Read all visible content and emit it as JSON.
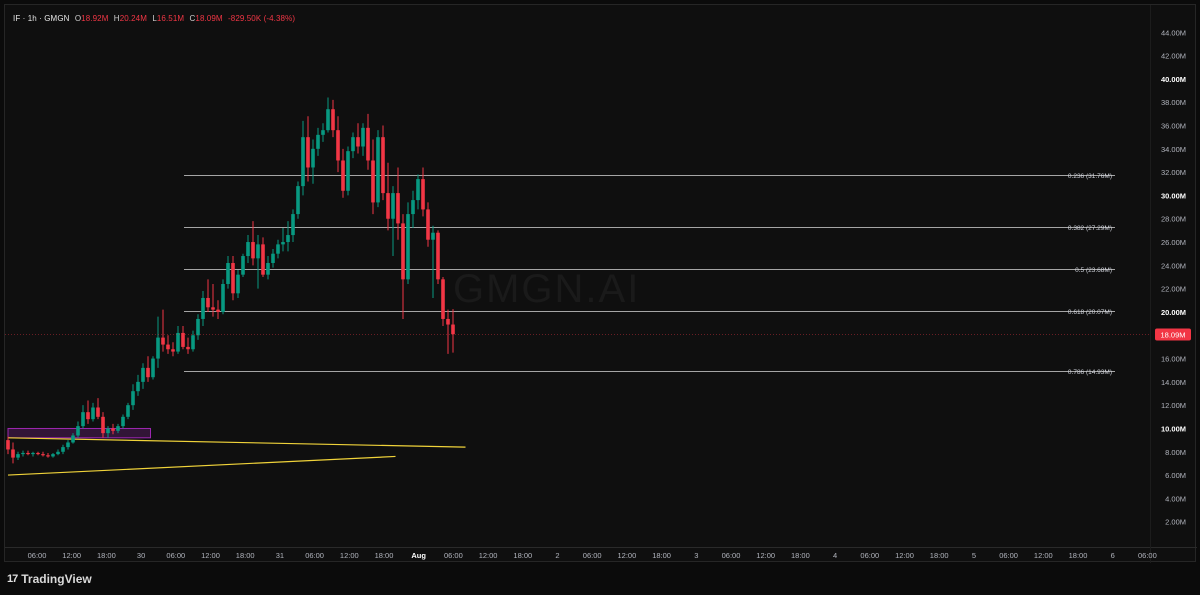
{
  "header": {
    "symbol": "IF · 1h · GMGN",
    "open_key": "O",
    "open": "18.92M",
    "high_key": "H",
    "high": "20.24M",
    "low_key": "L",
    "low": "16.51M",
    "close_key": "C",
    "close": "18.09M",
    "change": "-829.50K (-4.38%)"
  },
  "watermark": "GMGN.AI",
  "brand": {
    "icon": "tradingview-logo-icon",
    "name": "TradingView"
  },
  "colors": {
    "up": "#089981",
    "down": "#f23645",
    "fib_line": "#d9d9d9",
    "trendline": "#f0d33a",
    "box_border": "#9c27b0",
    "price_tag": "#f23645"
  },
  "chart_data": {
    "type": "candlestick",
    "interval": "1h",
    "y_axis": {
      "position": "right",
      "ticks": [
        "2.00M",
        "4.00M",
        "6.00M",
        "8.00M",
        "10.00M",
        "12.00M",
        "14.00M",
        "16.00M",
        "18.00M",
        "20.00M",
        "22.00M",
        "24.00M",
        "26.00M",
        "28.00M",
        "30.00M",
        "32.00M",
        "34.00M",
        "36.00M",
        "38.00M",
        "40.00M",
        "42.00M",
        "44.00M"
      ],
      "bold_ticks": [
        "10.00M",
        "20.00M",
        "30.00M",
        "40.00M"
      ],
      "range": [
        0,
        46
      ]
    },
    "x_axis": {
      "labels": [
        "06:00",
        "12:00",
        "18:00",
        "30",
        "06:00",
        "12:00",
        "18:00",
        "31",
        "06:00",
        "12:00",
        "18:00",
        "Aug",
        "06:00",
        "12:00",
        "18:00",
        "2",
        "06:00",
        "12:00",
        "18:00",
        "3",
        "06:00",
        "12:00",
        "18:00",
        "4",
        "06:00",
        "12:00",
        "18:00",
        "5",
        "06:00",
        "12:00",
        "18:00",
        "6",
        "06:00"
      ],
      "bold_labels": [
        "Aug"
      ]
    },
    "last_price_label": "18.09M",
    "last_price": 18.09,
    "fibonacci": [
      {
        "label": "0.236 (31.76M)",
        "value": 31.76
      },
      {
        "label": "0.382 (27.29M)",
        "value": 27.29
      },
      {
        "label": "0.5 (23.68M)",
        "value": 23.68
      },
      {
        "label": "0.618 (20.07M)",
        "value": 20.07
      },
      {
        "label": "0.786 (14.93M)",
        "value": 14.93
      }
    ],
    "candles": [
      [
        9.0,
        9.3,
        7.8,
        8.2
      ],
      [
        8.2,
        8.8,
        7.0,
        7.5
      ],
      [
        7.5,
        8.0,
        7.3,
        7.8
      ],
      [
        7.8,
        8.1,
        7.6,
        7.9
      ],
      [
        7.9,
        8.1,
        7.7,
        7.8
      ],
      [
        7.8,
        8.0,
        7.6,
        7.9
      ],
      [
        7.9,
        8.0,
        7.7,
        7.8
      ],
      [
        7.8,
        8.0,
        7.6,
        7.7
      ],
      [
        7.7,
        7.9,
        7.5,
        7.6
      ],
      [
        7.6,
        7.9,
        7.5,
        7.8
      ],
      [
        7.8,
        8.2,
        7.7,
        8.0
      ],
      [
        8.0,
        8.6,
        7.8,
        8.4
      ],
      [
        8.4,
        9.0,
        8.2,
        8.8
      ],
      [
        8.8,
        9.6,
        8.7,
        9.4
      ],
      [
        9.4,
        10.6,
        9.2,
        10.2
      ],
      [
        10.2,
        12.0,
        10.0,
        11.4
      ],
      [
        11.4,
        12.4,
        10.4,
        10.8
      ],
      [
        10.8,
        12.2,
        10.6,
        11.8
      ],
      [
        11.8,
        12.6,
        10.8,
        11.0
      ],
      [
        11.0,
        11.4,
        9.2,
        9.6
      ],
      [
        9.6,
        10.2,
        9.2,
        10.0
      ],
      [
        10.0,
        10.4,
        9.5,
        9.8
      ],
      [
        9.8,
        10.4,
        9.6,
        10.2
      ],
      [
        10.2,
        11.2,
        10.0,
        11.0
      ],
      [
        11.0,
        12.2,
        10.8,
        12.0
      ],
      [
        12.0,
        13.8,
        11.6,
        13.2
      ],
      [
        13.2,
        14.6,
        12.8,
        14.0
      ],
      [
        14.0,
        15.6,
        13.4,
        15.2
      ],
      [
        15.2,
        16.2,
        14.0,
        14.4
      ],
      [
        14.4,
        16.2,
        14.2,
        16.0
      ],
      [
        16.0,
        19.6,
        15.2,
        17.8
      ],
      [
        17.8,
        20.2,
        16.6,
        17.2
      ],
      [
        17.2,
        18.0,
        16.4,
        16.8
      ],
      [
        16.8,
        17.4,
        16.2,
        16.6
      ],
      [
        16.6,
        18.8,
        16.4,
        18.2
      ],
      [
        18.2,
        18.8,
        16.8,
        17.0
      ],
      [
        17.0,
        17.8,
        16.4,
        16.8
      ],
      [
        16.8,
        18.4,
        16.6,
        18.0
      ],
      [
        18.0,
        19.8,
        17.6,
        19.4
      ],
      [
        19.4,
        21.8,
        18.8,
        21.2
      ],
      [
        21.2,
        22.8,
        20.0,
        20.4
      ],
      [
        20.4,
        22.4,
        19.6,
        20.2
      ],
      [
        20.2,
        21.0,
        19.4,
        20.0
      ],
      [
        20.0,
        22.8,
        19.8,
        22.4
      ],
      [
        22.4,
        24.8,
        22.0,
        24.2
      ],
      [
        24.2,
        24.8,
        21.0,
        21.6
      ],
      [
        21.6,
        23.6,
        21.2,
        23.2
      ],
      [
        23.2,
        25.0,
        23.0,
        24.8
      ],
      [
        24.8,
        26.6,
        24.2,
        26.0
      ],
      [
        26.0,
        27.8,
        24.0,
        24.6
      ],
      [
        24.6,
        26.6,
        22.0,
        25.8
      ],
      [
        25.8,
        26.4,
        23.0,
        23.2
      ],
      [
        23.2,
        24.8,
        22.8,
        24.2
      ],
      [
        24.2,
        25.4,
        23.8,
        25.0
      ],
      [
        25.0,
        26.2,
        24.6,
        25.8
      ],
      [
        25.8,
        27.2,
        25.2,
        26.0
      ],
      [
        26.0,
        27.8,
        25.2,
        26.6
      ],
      [
        26.6,
        28.8,
        26.0,
        28.4
      ],
      [
        28.4,
        31.2,
        28.0,
        30.8
      ],
      [
        30.8,
        36.4,
        30.0,
        35.0
      ],
      [
        35.0,
        36.8,
        31.2,
        32.4
      ],
      [
        32.4,
        34.8,
        31.0,
        34.0
      ],
      [
        34.0,
        35.8,
        33.4,
        35.2
      ],
      [
        35.2,
        36.2,
        34.6,
        35.6
      ],
      [
        35.6,
        38.4,
        35.4,
        37.4
      ],
      [
        37.4,
        38.2,
        35.0,
        35.6
      ],
      [
        35.6,
        36.8,
        32.0,
        33.0
      ],
      [
        33.0,
        34.0,
        29.8,
        30.4
      ],
      [
        30.4,
        34.2,
        30.0,
        33.8
      ],
      [
        33.8,
        35.4,
        33.2,
        35.0
      ],
      [
        35.0,
        36.2,
        33.6,
        34.2
      ],
      [
        34.2,
        36.2,
        33.4,
        35.8
      ],
      [
        35.8,
        37.0,
        32.2,
        33.0
      ],
      [
        33.0,
        34.8,
        28.4,
        29.4
      ],
      [
        29.4,
        35.6,
        29.0,
        35.0
      ],
      [
        35.0,
        36.0,
        29.6,
        30.2
      ],
      [
        30.2,
        32.8,
        27.0,
        28.0
      ],
      [
        28.0,
        30.8,
        24.8,
        30.2
      ],
      [
        30.2,
        32.4,
        26.2,
        27.6
      ],
      [
        27.6,
        28.4,
        19.4,
        22.8
      ],
      [
        22.8,
        29.4,
        22.4,
        28.4
      ],
      [
        28.4,
        30.4,
        27.2,
        29.6
      ],
      [
        29.6,
        31.8,
        28.8,
        31.4
      ],
      [
        31.4,
        32.4,
        28.2,
        28.8
      ],
      [
        28.8,
        29.4,
        25.6,
        26.2
      ],
      [
        26.2,
        27.4,
        21.2,
        26.8
      ],
      [
        26.8,
        27.0,
        22.4,
        22.8
      ],
      [
        22.8,
        23.0,
        18.8,
        19.4
      ],
      [
        19.4,
        20.2,
        16.4,
        18.92
      ],
      [
        18.92,
        20.24,
        16.51,
        18.09
      ]
    ],
    "drawings": {
      "trendline_upper": {
        "from": [
          0,
          9.2
        ],
        "to": [
          57.5,
          8.4
        ]
      },
      "trendline_lower": {
        "from": [
          0,
          6.0
        ],
        "to": [
          47.5,
          7.6
        ]
      },
      "range_box": {
        "from": [
          0,
          10.0
        ],
        "to": [
          28.5,
          9.2
        ]
      }
    }
  }
}
